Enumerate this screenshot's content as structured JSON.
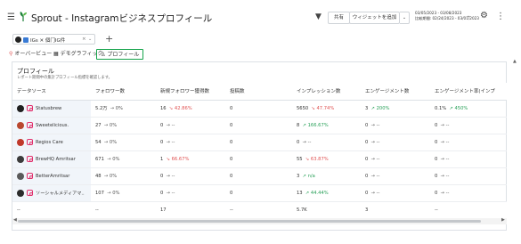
{
  "header": {
    "title": "Sprout - Instagramビジネスプロフィール",
    "share_label": "共有",
    "widget_label": "ウィジェットを追加",
    "date_range": "03/05/2023 - 03/08/2023",
    "compare_range": "比較期間: 02/24/2023 - 03/01/2023"
  },
  "profile_chip": {
    "network": "IG",
    "label": "IGs ✕  個门IG件"
  },
  "tabs": [
    {
      "label": "オーバービュー"
    },
    {
      "label": "デモグラフィック"
    },
    {
      "label": "プロフィール"
    }
  ],
  "card": {
    "title": "プロフィール",
    "subtitle": "レポート期間中の集計プロフィール指標を確認します。"
  },
  "columns": [
    "データソース",
    "フォロワー数",
    "新規フォロワー獲得数",
    "投稿数",
    "インプレッション数",
    "エンゲージメント数",
    "エンゲージメント率(インプ"
  ],
  "rows": [
    {
      "name": "Statusbrew",
      "avatar": "#1f1f1f",
      "followers": "5.2万",
      "followers_ch": "→ 0%",
      "new": "16",
      "new_ch": "↘ 42.86%",
      "new_dir": "down",
      "posts": "0",
      "impr": "5650",
      "impr_ch": "↘ 47.74%",
      "impr_dir": "down",
      "eng": "3",
      "eng_ch": "↗ 200%",
      "eng_dir": "up",
      "rate": "0.1%",
      "rate_ch": "↗ 450%",
      "rate_dir": "up"
    },
    {
      "name": "Sweetelicious.",
      "avatar": "#b9472e",
      "followers": "27",
      "followers_ch": "→ 0%",
      "new": "0",
      "new_ch": "→ --",
      "new_dir": "flat",
      "posts": "0",
      "impr": "8",
      "impr_ch": "↗ 166.67%",
      "impr_dir": "up",
      "eng": "0",
      "eng_ch": "→ --",
      "eng_dir": "flat",
      "rate": "0",
      "rate_ch": "→ --",
      "rate_dir": "flat"
    },
    {
      "name": "Regios Care",
      "avatar": "#c0392b",
      "followers": "54",
      "followers_ch": "→ 0%",
      "new": "0",
      "new_ch": "→ --",
      "new_dir": "flat",
      "posts": "0",
      "impr": "0",
      "impr_ch": "→ --",
      "impr_dir": "flat",
      "eng": "0",
      "eng_ch": "→ --",
      "eng_dir": "flat",
      "rate": "0",
      "rate_ch": "→ --",
      "rate_dir": "flat"
    },
    {
      "name": "BrewHQ Amritsar",
      "avatar": "#3b3b3b",
      "followers": "671",
      "followers_ch": "→ 0%",
      "new": "1",
      "new_ch": "↘ 66.67%",
      "new_dir": "down",
      "posts": "0",
      "impr": "55",
      "impr_ch": "↘ 63.87%",
      "impr_dir": "down",
      "eng": "0",
      "eng_ch": "→ --",
      "eng_dir": "flat",
      "rate": "0",
      "rate_ch": "→ --",
      "rate_dir": "flat"
    },
    {
      "name": "BetterAmritsar",
      "avatar": "#5a5a5a",
      "followers": "48",
      "followers_ch": "→ 0%",
      "new": "0",
      "new_ch": "→ --",
      "new_dir": "flat",
      "posts": "0",
      "impr": "3",
      "impr_ch": "↗ n/a",
      "impr_dir": "up",
      "eng": "0",
      "eng_ch": "→ --",
      "eng_dir": "flat",
      "rate": "0",
      "rate_ch": "→ --",
      "rate_dir": "flat"
    },
    {
      "name": "ソーシャルメディアマ..",
      "avatar": "#2b2b2b",
      "followers": "107",
      "followers_ch": "→ 0%",
      "new": "0",
      "new_ch": "→ --",
      "new_dir": "flat",
      "posts": "0",
      "impr": "13",
      "impr_ch": "↗ 44.44%",
      "impr_dir": "up",
      "eng": "0",
      "eng_ch": "→ --",
      "eng_dir": "flat",
      "rate": "0",
      "rate_ch": "→ --",
      "rate_dir": "flat"
    }
  ],
  "totals": {
    "name": "--",
    "followers": "--",
    "new": "17",
    "posts": "--",
    "impr": "5.7K",
    "eng": "3",
    "rate": "--"
  }
}
